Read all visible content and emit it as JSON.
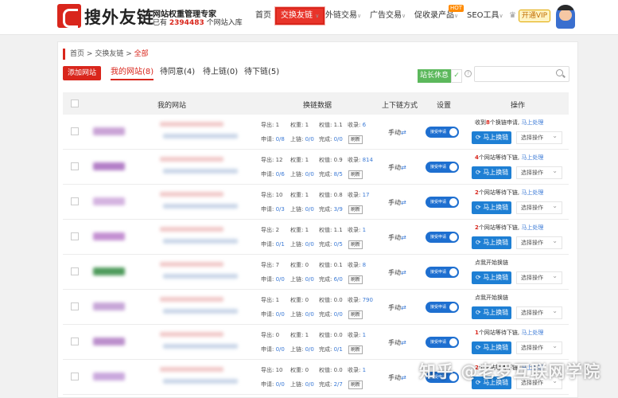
{
  "header": {
    "brand": "搜外友链",
    "slogan": "网站权重管理专家",
    "sub_prefix": "已有",
    "site_count": "2394483",
    "sub_suffix": "个网站入库",
    "nav": [
      {
        "label": "首页",
        "active": false
      },
      {
        "label": "交换友链",
        "active": true
      },
      {
        "label": "外链交易",
        "active": false
      },
      {
        "label": "广告交易",
        "active": false
      },
      {
        "label": "促收录产品",
        "active": false
      },
      {
        "label": "SEO工具",
        "active": false
      }
    ],
    "hot_badge": "HOT",
    "vip_label": "开通VIP"
  },
  "breadcrumb": {
    "home": "首页",
    "section": "交换友链",
    "current": "全部",
    "sep": ">"
  },
  "toolbar": {
    "add_site": "添加网站",
    "tabs": [
      "我的网站(8)",
      "待同意(4)",
      "待上链(0)",
      "待下链(5)"
    ],
    "rest_label": "站长休息",
    "check": "✓",
    "help": "?",
    "search_placeholder": ""
  },
  "table": {
    "headers": [
      "我的网站",
      "换链数据",
      "上下链方式",
      "设置",
      "操作"
    ],
    "labels": {
      "export": "导出:",
      "weight": "权重:",
      "weight_value": "权值:",
      "indexed": "收录:",
      "apply": "申请:",
      "linked": "上链:",
      "done": "完成:",
      "refresh": "刷新",
      "mode": "手动",
      "toggle": "接受申请",
      "swap": "马上换链",
      "select": "选择操作",
      "process": "马上处理",
      "start": "点我开始换链"
    },
    "rows": [
      {
        "export": "1",
        "weight": "1",
        "wval": "1.1",
        "indexed": "6",
        "apply": "0/8",
        "linked": "0/0",
        "done": "0/0",
        "msg_pre": "收到",
        "msg_num": "8",
        "msg_post": "个换链申请,",
        "msg_link": true
      },
      {
        "export": "12",
        "weight": "1",
        "wval": "0.9",
        "indexed": "814",
        "apply": "0/6",
        "linked": "0/0",
        "done": "8/5",
        "msg_pre": "",
        "msg_num": "4",
        "msg_post": "个网站等待下链,",
        "msg_link": true
      },
      {
        "export": "10",
        "weight": "1",
        "wval": "0.8",
        "indexed": "17",
        "apply": "0/3",
        "linked": "0/0",
        "done": "3/9",
        "msg_pre": "",
        "msg_num": "2",
        "msg_post": "个网站等待下链,",
        "msg_link": true
      },
      {
        "export": "2",
        "weight": "1",
        "wval": "1.1",
        "indexed": "1",
        "apply": "0/1",
        "linked": "0/0",
        "done": "0/5",
        "msg_pre": "",
        "msg_num": "2",
        "msg_post": "个网站等待下链,",
        "msg_link": true
      },
      {
        "export": "7",
        "weight": "0",
        "wval": "0.1",
        "indexed": "8",
        "apply": "0/0",
        "linked": "0/0",
        "done": "6/0",
        "msg_pre": "点我开始换链",
        "msg_num": "",
        "msg_post": "",
        "msg_link": false
      },
      {
        "export": "1",
        "weight": "0",
        "wval": "0.0",
        "indexed": "790",
        "apply": "0/0",
        "linked": "0/0",
        "done": "0/0",
        "msg_pre": "点我开始换链",
        "msg_num": "",
        "msg_post": "",
        "msg_link": false
      },
      {
        "export": "0",
        "weight": "1",
        "wval": "0.0",
        "indexed": "1",
        "apply": "0/0",
        "linked": "0/0",
        "done": "0/1",
        "msg_pre": "",
        "msg_num": "1",
        "msg_post": "个网站等待下链,",
        "msg_link": true
      },
      {
        "export": "10",
        "weight": "0",
        "wval": "0.0",
        "indexed": "1",
        "apply": "0/0",
        "linked": "0/0",
        "done": "2/7",
        "msg_pre": "",
        "msg_num": "2",
        "msg_post": "个网站等待下链,",
        "msg_link": true
      }
    ]
  },
  "watermark": "知乎 @老罗互联网学院",
  "colors": {
    "brand_red": "#d9261c",
    "link_blue": "#3d7bd6",
    "toggle_blue": "#1e6fd0",
    "rest_green": "#5cb85c"
  }
}
